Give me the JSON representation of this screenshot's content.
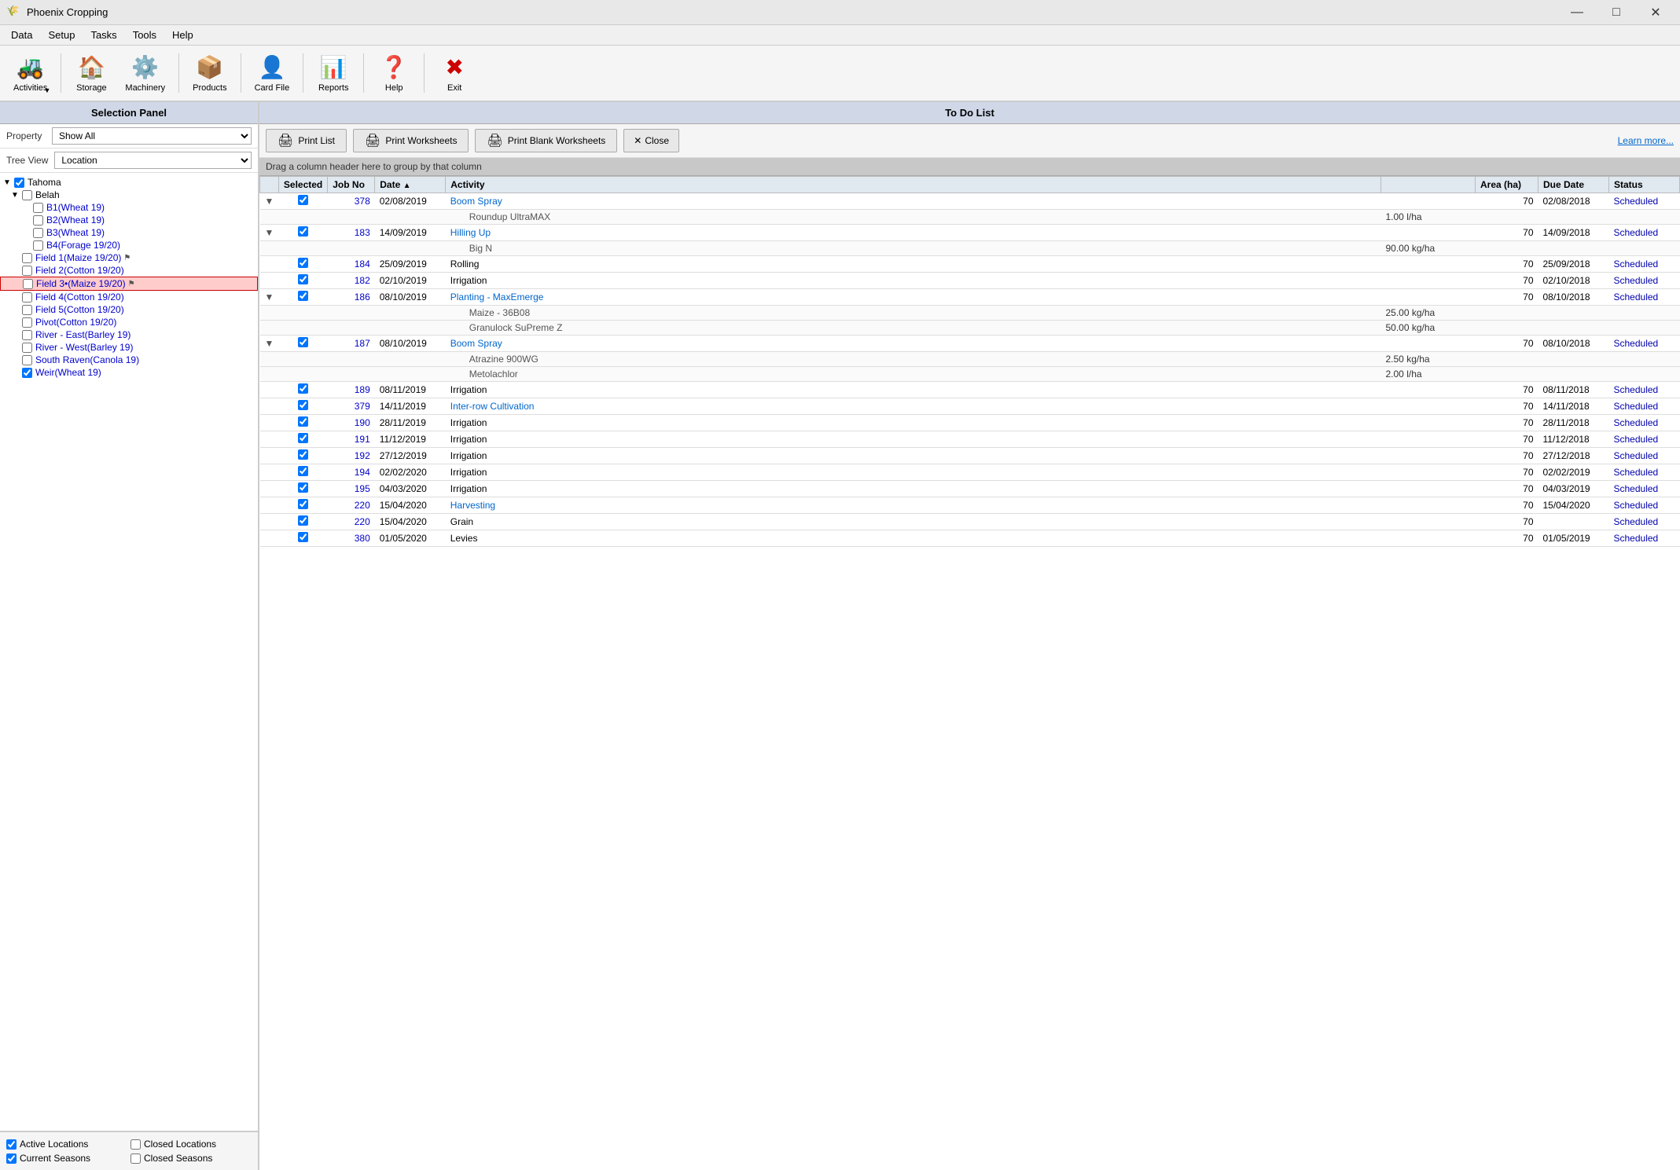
{
  "app": {
    "title": "Phoenix Cropping",
    "icon": "🌾"
  },
  "titlebar": {
    "minimize": "—",
    "maximize": "□",
    "close": "✕"
  },
  "menubar": {
    "items": [
      "Data",
      "Setup",
      "Tasks",
      "Tools",
      "Help"
    ]
  },
  "toolbar": {
    "items": [
      {
        "id": "activities",
        "label": "Activities",
        "icon": "🚜",
        "has_arrow": true
      },
      {
        "id": "storage",
        "label": "Storage",
        "icon": "🏠",
        "has_arrow": false
      },
      {
        "id": "machinery",
        "label": "Machinery",
        "icon": "⚙️",
        "has_arrow": false
      },
      {
        "id": "products",
        "label": "Products",
        "icon": "📦",
        "has_arrow": false
      },
      {
        "id": "cardfile",
        "label": "Card File",
        "icon": "👤",
        "has_arrow": false
      },
      {
        "id": "reports",
        "label": "Reports",
        "icon": "📊",
        "has_arrow": false
      },
      {
        "id": "help",
        "label": "Help",
        "icon": "❓",
        "has_arrow": false
      },
      {
        "id": "exit",
        "label": "Exit",
        "icon": "✖",
        "has_arrow": false,
        "is_exit": true
      }
    ]
  },
  "left_panel": {
    "header": "Selection Panel",
    "property_label": "Property",
    "property_value": "Show All",
    "treeview_label": "Tree View",
    "treeview_value": "Location",
    "tree": [
      {
        "id": "tahoma",
        "label": "Tahoma",
        "indent": 0,
        "checked": true,
        "expanded": true,
        "is_root": true
      },
      {
        "id": "belah",
        "label": "Belah",
        "indent": 1,
        "checked": false,
        "expanded": true,
        "is_group": true
      },
      {
        "id": "b1wheat",
        "label": "B1(Wheat 19)",
        "indent": 2,
        "checked": false,
        "color": "blue"
      },
      {
        "id": "b2wheat",
        "label": "B2(Wheat 19)",
        "indent": 2,
        "checked": false,
        "color": "blue"
      },
      {
        "id": "b3wheat",
        "label": "B3(Wheat 19)",
        "indent": 2,
        "checked": false,
        "color": "blue"
      },
      {
        "id": "b4forage",
        "label": "B4(Forage 19/20)",
        "indent": 2,
        "checked": false,
        "color": "blue"
      },
      {
        "id": "field1",
        "label": "Field 1(Maize 19/20)",
        "indent": 1,
        "checked": false,
        "color": "blue",
        "has_icon": true
      },
      {
        "id": "field2",
        "label": "Field 2(Cotton 19/20)",
        "indent": 1,
        "checked": false,
        "color": "blue"
      },
      {
        "id": "field3",
        "label": "Field 3•(Maize 19/20)",
        "indent": 1,
        "checked": false,
        "color": "blue",
        "selected": true,
        "has_icon": true
      },
      {
        "id": "field4",
        "label": "Field 4(Cotton 19/20)",
        "indent": 1,
        "checked": false,
        "color": "blue"
      },
      {
        "id": "field5",
        "label": "Field 5(Cotton 19/20)",
        "indent": 1,
        "checked": false,
        "color": "blue"
      },
      {
        "id": "pivot",
        "label": "Pivot(Cotton 19/20)",
        "indent": 1,
        "checked": false,
        "color": "blue"
      },
      {
        "id": "river_east",
        "label": "River - East(Barley 19)",
        "indent": 1,
        "checked": false,
        "color": "blue"
      },
      {
        "id": "river_west",
        "label": "River - West(Barley 19)",
        "indent": 1,
        "checked": false,
        "color": "blue"
      },
      {
        "id": "south_raven",
        "label": "South Raven(Canola 19)",
        "indent": 1,
        "checked": false,
        "color": "blue"
      },
      {
        "id": "weir",
        "label": "Weir(Wheat 19)",
        "indent": 1,
        "checked": true,
        "color": "blue"
      }
    ],
    "bottom_checks": [
      {
        "id": "active_locations",
        "label": "Active Locations",
        "checked": true
      },
      {
        "id": "closed_locations",
        "label": "Closed Locations",
        "checked": false
      },
      {
        "id": "current_seasons",
        "label": "Current Seasons",
        "checked": true
      },
      {
        "id": "closed_seasons",
        "label": "Closed Seasons",
        "checked": false
      }
    ]
  },
  "right_panel": {
    "header": "To Do List",
    "action_bar": {
      "print_list": "Print List",
      "print_worksheets": "Print Worksheets",
      "print_blank": "Print Blank Worksheets",
      "close": "Close",
      "learn_more": "Learn more..."
    },
    "group_header": "Drag a column header here to group by that column",
    "columns": [
      "",
      "Selected",
      "Job No",
      "Date",
      "Activity",
      "",
      "Area (ha)",
      "Due Date",
      "Status"
    ],
    "rows": [
      {
        "id": 1,
        "expandable": true,
        "selected": true,
        "job_no": "378",
        "date": "02/08/2019",
        "activity": "Boom Spray",
        "activity_link": true,
        "area": "70",
        "due_date": "02/08/2018",
        "status": "Scheduled",
        "sub_rows": [
          {
            "name": "Roundup UltraMAX",
            "value": "1.00 l/ha"
          }
        ]
      },
      {
        "id": 2,
        "expandable": true,
        "selected": true,
        "job_no": "183",
        "date": "14/09/2019",
        "activity": "Hilling Up",
        "activity_link": true,
        "area": "70",
        "due_date": "14/09/2018",
        "status": "Scheduled",
        "sub_rows": [
          {
            "name": "Big N",
            "value": "90.00 kg/ha"
          }
        ]
      },
      {
        "id": 3,
        "expandable": false,
        "selected": true,
        "job_no": "184",
        "date": "25/09/2019",
        "activity": "Rolling",
        "activity_link": false,
        "area": "70",
        "due_date": "25/09/2018",
        "status": "Scheduled"
      },
      {
        "id": 4,
        "expandable": false,
        "selected": true,
        "job_no": "182",
        "date": "02/10/2019",
        "activity": "Irrigation",
        "activity_link": false,
        "area": "70",
        "due_date": "02/10/2018",
        "status": "Scheduled"
      },
      {
        "id": 5,
        "expandable": true,
        "selected": true,
        "job_no": "186",
        "date": "08/10/2019",
        "activity": "Planting - MaxEmerge",
        "activity_link": true,
        "area": "70",
        "due_date": "08/10/2018",
        "status": "Scheduled",
        "sub_rows": [
          {
            "name": "Maize - 36B08",
            "value": "25.00 kg/ha"
          },
          {
            "name": "Granulock SuPreme Z",
            "value": "50.00 kg/ha"
          }
        ]
      },
      {
        "id": 6,
        "expandable": true,
        "selected": true,
        "job_no": "187",
        "date": "08/10/2019",
        "activity": "Boom Spray",
        "activity_link": true,
        "area": "70",
        "due_date": "08/10/2018",
        "status": "Scheduled",
        "sub_rows": [
          {
            "name": "Atrazine 900WG",
            "value": "2.50 kg/ha"
          },
          {
            "name": "Metolachlor",
            "value": "2.00 l/ha"
          }
        ]
      },
      {
        "id": 7,
        "expandable": false,
        "selected": true,
        "job_no": "189",
        "date": "08/11/2019",
        "activity": "Irrigation",
        "activity_link": false,
        "area": "70",
        "due_date": "08/11/2018",
        "status": "Scheduled"
      },
      {
        "id": 8,
        "expandable": false,
        "selected": true,
        "job_no": "379",
        "date": "14/11/2019",
        "activity": "Inter-row Cultivation",
        "activity_link": true,
        "area": "70",
        "due_date": "14/11/2018",
        "status": "Scheduled"
      },
      {
        "id": 9,
        "expandable": false,
        "selected": true,
        "job_no": "190",
        "date": "28/11/2019",
        "activity": "Irrigation",
        "activity_link": false,
        "area": "70",
        "due_date": "28/11/2018",
        "status": "Scheduled"
      },
      {
        "id": 10,
        "expandable": false,
        "selected": true,
        "job_no": "191",
        "date": "11/12/2019",
        "activity": "Irrigation",
        "activity_link": false,
        "area": "70",
        "due_date": "11/12/2018",
        "status": "Scheduled"
      },
      {
        "id": 11,
        "expandable": false,
        "selected": true,
        "job_no": "192",
        "date": "27/12/2019",
        "activity": "Irrigation",
        "activity_link": false,
        "area": "70",
        "due_date": "27/12/2018",
        "status": "Scheduled"
      },
      {
        "id": 12,
        "expandable": false,
        "selected": true,
        "job_no": "194",
        "date": "02/02/2020",
        "activity": "Irrigation",
        "activity_link": false,
        "area": "70",
        "due_date": "02/02/2019",
        "status": "Scheduled"
      },
      {
        "id": 13,
        "expandable": false,
        "selected": true,
        "job_no": "195",
        "date": "04/03/2020",
        "activity": "Irrigation",
        "activity_link": false,
        "area": "70",
        "due_date": "04/03/2019",
        "status": "Scheduled"
      },
      {
        "id": 14,
        "expandable": false,
        "selected": true,
        "job_no": "220",
        "date": "15/04/2020",
        "activity": "Harvesting",
        "activity_link": true,
        "area": "70",
        "due_date": "15/04/2020",
        "status": "Scheduled"
      },
      {
        "id": 15,
        "expandable": false,
        "selected": true,
        "job_no": "220",
        "date": "15/04/2020",
        "activity": "Grain",
        "activity_link": false,
        "area": "70",
        "due_date": "",
        "status": "Scheduled"
      },
      {
        "id": 16,
        "expandable": false,
        "selected": true,
        "job_no": "380",
        "date": "01/05/2020",
        "activity": "Levies",
        "activity_link": false,
        "area": "70",
        "due_date": "01/05/2019",
        "status": "Scheduled"
      }
    ]
  }
}
